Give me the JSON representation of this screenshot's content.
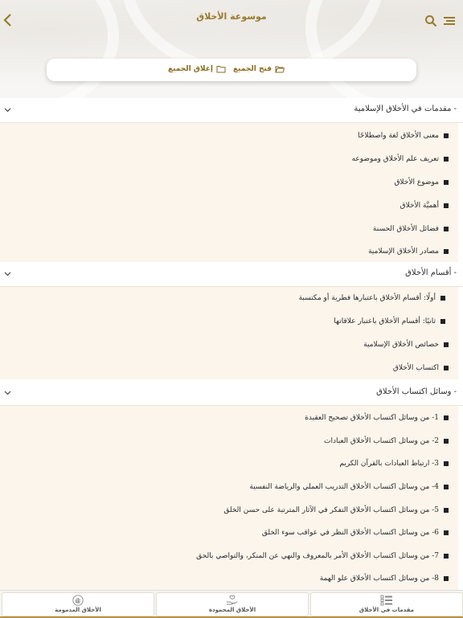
{
  "header": {
    "title": "موسوعة الأخلاق",
    "expand_all": "فتح الجميع",
    "collapse_all": "إغلاق الجميع"
  },
  "sections": [
    {
      "title": "- مقدمات في الأخلاق الإسلامية",
      "items": [
        "معنى الأخلاق لغة واصطلاحًا",
        "تعريف علم الأخلاق وموضوعه",
        "موضوع الأخلاق",
        "أهميَّة الأخلاق",
        "فضائل الأخلاق الحسنة",
        "مصادر الأخلاق الإسلامية"
      ]
    },
    {
      "title": "- أقسام الأخلاق",
      "items": [
        "أولًا: أقسام الأخلاق باعتبارها فطرية أو مكتسبة",
        "ثانيًا: أقسام الأخلاق باعتبار علاقاتها",
        "خصائص الأخلاق الإسلامية",
        "اكتساب الأخلاق"
      ]
    },
    {
      "title": "- وسائل اكتساب الأخلاق",
      "items": [
        "1- من وسائل اكتساب الأخلاق تصحيح العقيدة",
        "2- من وسائل اكتساب الأخلاق العبادات",
        "3- ارتباط العبادات بالقرآن الكريم",
        "4- من وسائل اكتساب الأخلاق التدريب العملي والرياضة النفسية",
        "5- من وسائل اكتساب الأخلاق التفكر في الآثار المترتبة على حسن الخلق",
        "6- من وسائل اكتساب الأخلاق النظر في عواقب سوء الخلق",
        "7- من وسائل اكتساب الأخلاق الأمر بالمعروف والنهي عن المنكر، والتواصي بالحق",
        "8- من وسائل اكتساب الأخلاق علو الهمة"
      ]
    }
  ],
  "tabs": [
    {
      "label": "مقدمات في الأخلاق",
      "icon": "list-icon"
    },
    {
      "label": "الأخلاق المحمودة",
      "icon": "hand-heart-icon"
    },
    {
      "label": "الأخلاق المذمومة",
      "icon": "hand-stop-icon"
    }
  ],
  "colors": {
    "accent": "#9a7a2e",
    "section_bg": "#fbf5ec"
  }
}
